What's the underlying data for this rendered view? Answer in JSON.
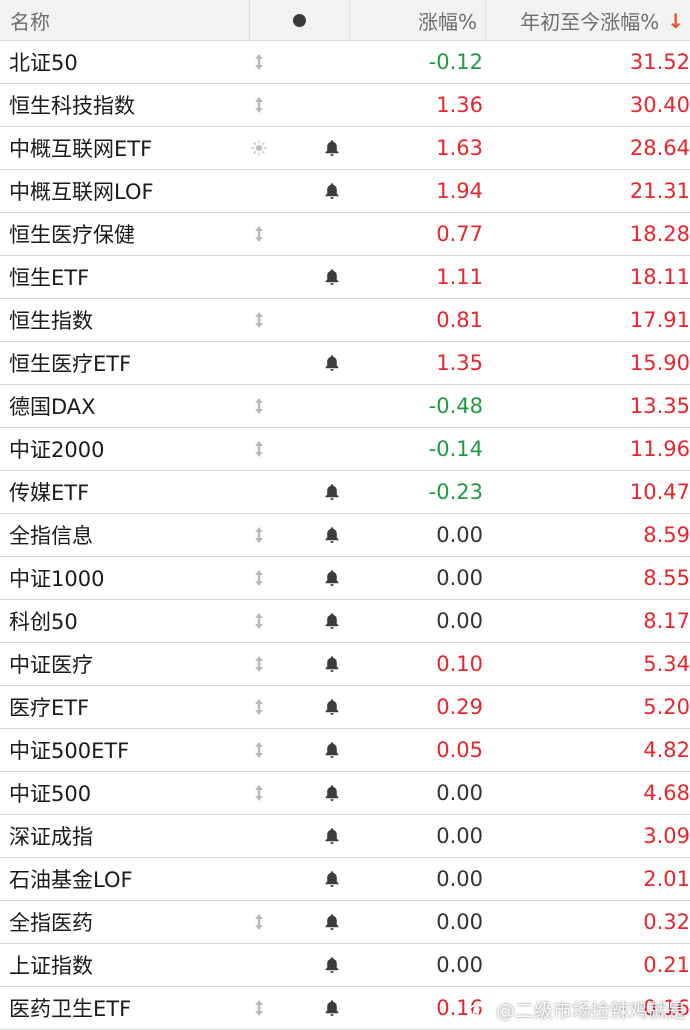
{
  "header": {
    "name_label": "名称",
    "change_label": "涨幅%",
    "ytd_label": "年初至今涨幅%",
    "sort_arrow": "↓"
  },
  "colors": {
    "up": "#e8242c",
    "down": "#1e9b41",
    "flat": "#333333",
    "header_bg": "#f2f2f2"
  },
  "rows": [
    {
      "name": "北证50",
      "indicator": "updown-icon",
      "bell": false,
      "change": "-0.12",
      "ytd": "31.52"
    },
    {
      "name": "恒生科技指数",
      "indicator": "updown-icon",
      "bell": false,
      "change": "1.36",
      "ytd": "30.40"
    },
    {
      "name": "中概互联网ETF",
      "indicator": "sun-icon",
      "bell": true,
      "change": "1.63",
      "ytd": "28.64"
    },
    {
      "name": "中概互联网LOF",
      "indicator": "",
      "bell": true,
      "change": "1.94",
      "ytd": "21.31"
    },
    {
      "name": "恒生医疗保健",
      "indicator": "updown-icon",
      "bell": false,
      "change": "0.77",
      "ytd": "18.28"
    },
    {
      "name": "恒生ETF",
      "indicator": "",
      "bell": true,
      "change": "1.11",
      "ytd": "18.11"
    },
    {
      "name": "恒生指数",
      "indicator": "updown-icon",
      "bell": false,
      "change": "0.81",
      "ytd": "17.91"
    },
    {
      "name": "恒生医疗ETF",
      "indicator": "",
      "bell": true,
      "change": "1.35",
      "ytd": "15.90"
    },
    {
      "name": "德国DAX",
      "indicator": "updown-icon",
      "bell": false,
      "change": "-0.48",
      "ytd": "13.35"
    },
    {
      "name": "中证2000",
      "indicator": "updown-icon",
      "bell": false,
      "change": "-0.14",
      "ytd": "11.96"
    },
    {
      "name": "传媒ETF",
      "indicator": "",
      "bell": true,
      "change": "-0.23",
      "ytd": "10.47"
    },
    {
      "name": "全指信息",
      "indicator": "updown-icon",
      "bell": true,
      "change": "0.00",
      "ytd": "8.59"
    },
    {
      "name": "中证1000",
      "indicator": "updown-icon",
      "bell": true,
      "change": "0.00",
      "ytd": "8.55"
    },
    {
      "name": "科创50",
      "indicator": "updown-icon",
      "bell": true,
      "change": "0.00",
      "ytd": "8.17"
    },
    {
      "name": "中证医疗",
      "indicator": "updown-icon",
      "bell": true,
      "change": "0.10",
      "ytd": "5.34"
    },
    {
      "name": "医疗ETF",
      "indicator": "updown-icon",
      "bell": true,
      "change": "0.29",
      "ytd": "5.20"
    },
    {
      "name": "中证500ETF",
      "indicator": "updown-icon",
      "bell": true,
      "change": "0.05",
      "ytd": "4.82"
    },
    {
      "name": "中证500",
      "indicator": "updown-icon",
      "bell": true,
      "change": "0.00",
      "ytd": "4.68"
    },
    {
      "name": "深证成指",
      "indicator": "",
      "bell": true,
      "change": "0.00",
      "ytd": "3.09"
    },
    {
      "name": "石油基金LOF",
      "indicator": "",
      "bell": true,
      "change": "0.00",
      "ytd": "2.01"
    },
    {
      "name": "全指医药",
      "indicator": "updown-icon",
      "bell": true,
      "change": "0.00",
      "ytd": "0.32"
    },
    {
      "name": "上证指数",
      "indicator": "",
      "bell": true,
      "change": "0.00",
      "ytd": "0.21"
    },
    {
      "name": "医药卫生ETF",
      "indicator": "updown-icon",
      "bell": true,
      "change": "0.16",
      "ytd": "0.16"
    }
  ],
  "watermark": {
    "text": "@二级市场捡辣鸡就是",
    "icon": "weibo-icon"
  }
}
